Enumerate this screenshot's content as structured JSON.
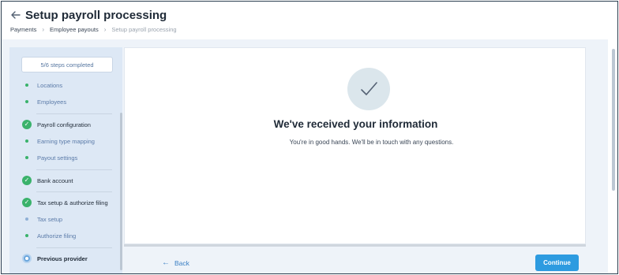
{
  "header": {
    "title": "Setup payroll processing",
    "breadcrumb": [
      "Payments",
      "Employee payouts",
      "Setup payroll processing"
    ],
    "back_icon": "arrow-left-icon"
  },
  "sidebar": {
    "progress": "5/6 steps completed",
    "steps": [
      {
        "label": "Locations",
        "type": "sub",
        "status": "complete"
      },
      {
        "label": "Employees",
        "type": "sub",
        "status": "complete"
      },
      {
        "label": "Payroll configuration",
        "type": "main",
        "status": "complete"
      },
      {
        "label": "Earning type mapping",
        "type": "sub",
        "status": "complete"
      },
      {
        "label": "Payout settings",
        "type": "sub",
        "status": "complete"
      },
      {
        "label": "Bank account",
        "type": "main",
        "status": "complete"
      },
      {
        "label": "Tax setup & authorize filing",
        "type": "main",
        "status": "complete"
      },
      {
        "label": "Tax setup",
        "type": "sub",
        "status": "pending"
      },
      {
        "label": "Authorize filing",
        "type": "sub",
        "status": "complete"
      },
      {
        "label": "Previous provider",
        "type": "main",
        "status": "current"
      }
    ]
  },
  "main": {
    "icon": "checkmark-icon",
    "heading": "We've received your information",
    "message": "You're in good hands. We'll be in touch with any questions."
  },
  "footer": {
    "back_label": "Back",
    "continue_label": "Continue"
  },
  "colors": {
    "accent": "#2d9be0",
    "success": "#3ab26b",
    "link": "#3a7fc4",
    "sidebar_bg": "#dde8f5"
  }
}
